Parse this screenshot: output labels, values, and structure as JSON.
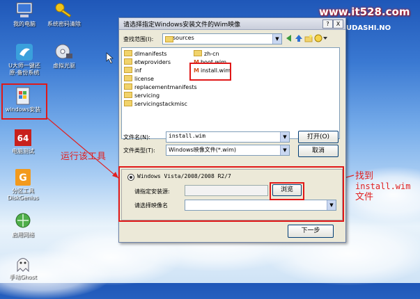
{
  "watermark": "www.it528.com",
  "desktop_icons": [
    {
      "label": "我的电脑",
      "icon": "computer-icon"
    },
    {
      "label": "系统密码清除",
      "icon": "key-icon"
    },
    {
      "label": "U大师一键还\n原-备份系统",
      "icon": "bird-icon"
    },
    {
      "label": "虚拟光驱",
      "icon": "cd-drive-icon"
    },
    {
      "label": "windows安装",
      "icon": "windows-setup-icon"
    },
    {
      "label": "电脑测试",
      "icon": "test-64-icon"
    },
    {
      "label": "分区工具\nDiskGenius",
      "icon": "diskgenius-icon"
    },
    {
      "label": "启用网络",
      "icon": "network-icon"
    },
    {
      "label": "手动Ghost",
      "icon": "ghost-icon"
    }
  ],
  "annotations": {
    "run_tool": "运行该工具",
    "find_file_line1": "找到",
    "find_file_line2": "install.wim",
    "find_file_line3": "文件"
  },
  "dialog": {
    "title": "请选择指定Windows安装文件的Wim映像",
    "help_btn": "?",
    "close_btn": "X",
    "lookin_label": "查找范围(I):",
    "lookin_value": "sources",
    "files_col1": [
      "dlmanifests",
      "etwproviders",
      "inf",
      "license",
      "replacementmanifests",
      "servicing",
      "servicingstackmisc"
    ],
    "files_col2": [
      "zh-cn",
      "boot.wim",
      "install.wim"
    ],
    "filename_label": "文件名(N):",
    "filename_value": "install.wim",
    "filetype_label": "文件类型(T):",
    "filetype_value": "Windows映像文件(*.wim)",
    "open_btn": "打开(O)",
    "cancel_btn": "取消"
  },
  "installer": {
    "radio_label": "Windows Vista/2008/2008 R2/7",
    "source_label": "请指定安装源:",
    "browse_btn": "浏览",
    "image_label": "请选择映像名",
    "next_btn": "下一步"
  },
  "partial_brand": "UDASHI.NO"
}
